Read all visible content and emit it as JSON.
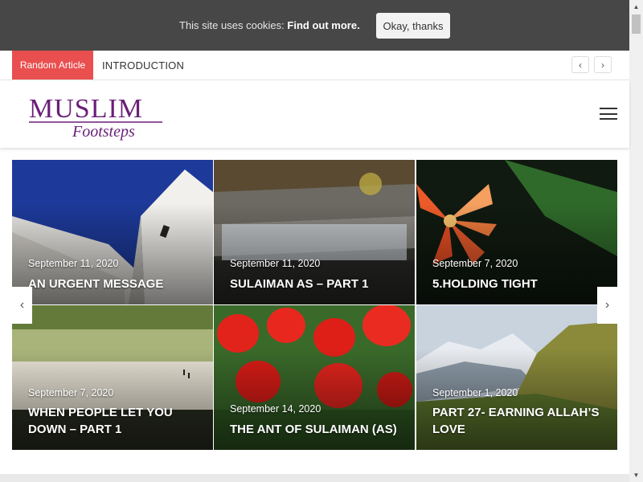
{
  "cookie_bar": {
    "text": "This site uses cookies:",
    "link": "Find out more.",
    "button": "Okay, thanks"
  },
  "ticker": {
    "label": "Random Article",
    "title": "INTRODUCTION",
    "prev_icon": "chevron-left-icon",
    "next_icon": "chevron-right-icon"
  },
  "header": {
    "logo_line1": "MUSLIM",
    "logo_line2": "Footsteps",
    "logo_color": "#6a1f78",
    "menu_icon": "hamburger-menu-icon"
  },
  "articles": [
    {
      "date": "September 11, 2020",
      "title": "AN URGENT MESSAGE"
    },
    {
      "date": "September 11, 2020",
      "title": "SULAIMAN AS – PART 1"
    },
    {
      "date": "September 7, 2020",
      "title": "5.HOLDING TIGHT"
    },
    {
      "date": "September 7, 2020",
      "title": "WHEN PEOPLE LET YOU DOWN – PART 1"
    },
    {
      "date": "September 14, 2020",
      "title": "THE ANT OF SULAIMAN (AS)"
    },
    {
      "date": "September 1, 2020",
      "title": "PART 27- EARNING ALLAH’S LOVE"
    }
  ],
  "colors": {
    "accent": "#ea4f4f",
    "cookie_bar": "#474747"
  }
}
